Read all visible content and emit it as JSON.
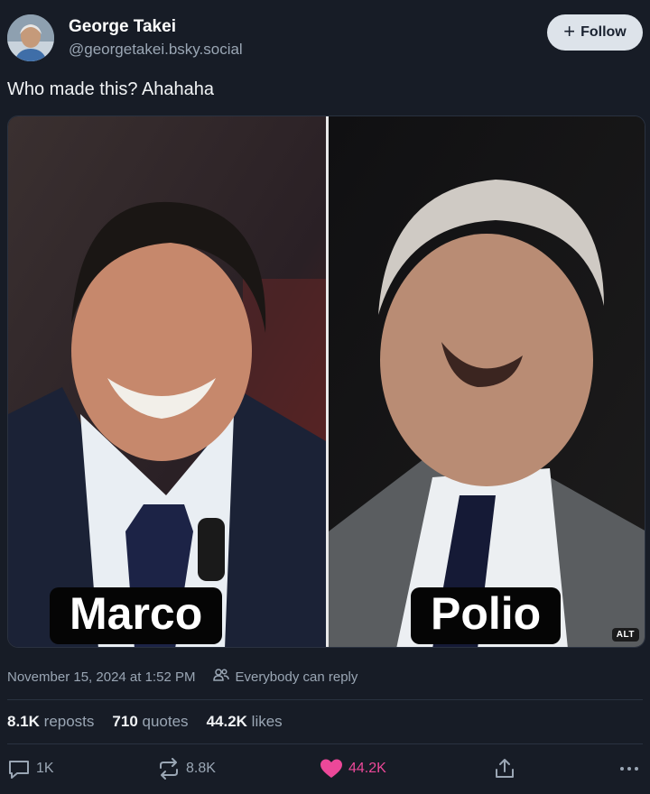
{
  "author": {
    "display_name": "George Takei",
    "handle": "@georgetakei.bsky.social"
  },
  "follow_button": {
    "label": "Follow"
  },
  "post": {
    "text": "Who made this? Ahahaha",
    "image": {
      "captions": [
        "Marco",
        "Polio"
      ],
      "alt_badge": "ALT"
    },
    "timestamp": "November 15, 2024 at 1:52 PM",
    "reply_setting": "Everybody can reply"
  },
  "stats": {
    "reposts_count": "8.1K",
    "reposts_label": "reposts",
    "quotes_count": "710",
    "quotes_label": "quotes",
    "likes_count": "44.2K",
    "likes_label": "likes"
  },
  "actions": {
    "reply_count": "1K",
    "repost_count": "8.8K",
    "like_count": "44.2K"
  },
  "colors": {
    "background": "#171c26",
    "like_pink": "#ec4899",
    "muted": "#9aa6b4"
  }
}
